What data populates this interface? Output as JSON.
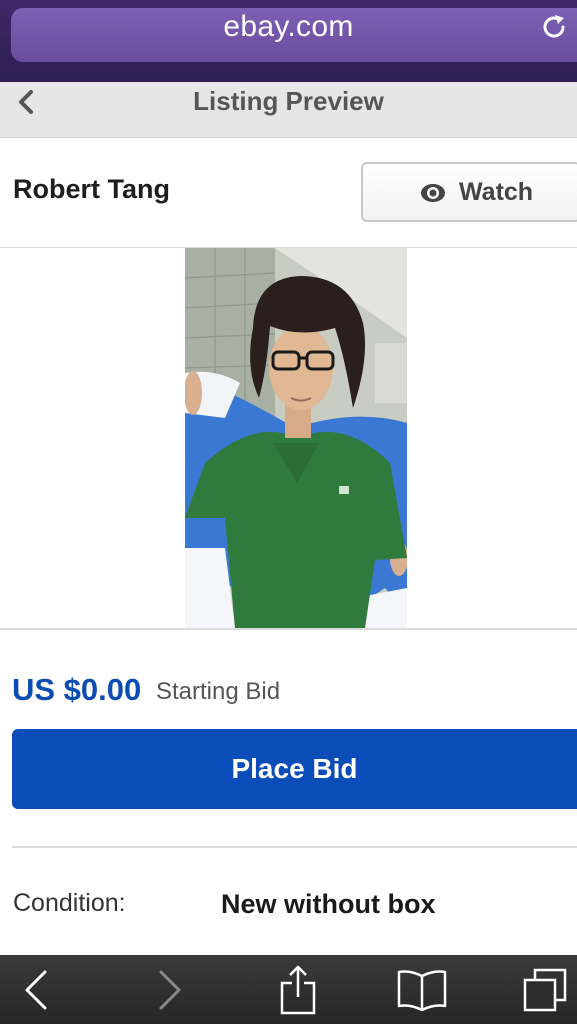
{
  "browser": {
    "url": "ebay.com",
    "icons": {
      "reload": "reload-icon"
    }
  },
  "header": {
    "title": "Listing Preview",
    "icons": {
      "back": "chevron-left-icon"
    }
  },
  "seller": {
    "name": "Robert Tang",
    "watch_label": "Watch",
    "icons": {
      "watch": "eye-icon"
    }
  },
  "listing": {
    "price": "US $0.00",
    "price_label": "Starting Bid",
    "place_bid_label": "Place Bid",
    "condition_label": "Condition:",
    "condition_value": "New without box"
  },
  "toolbar": {
    "icons": [
      "back-arrow-icon",
      "forward-arrow-icon",
      "share-icon",
      "bookmarks-icon",
      "tabs-icon"
    ]
  },
  "colors": {
    "accent": "#0a4cb8",
    "price": "#0c4db3",
    "url_bar": "#6a4c9f"
  }
}
